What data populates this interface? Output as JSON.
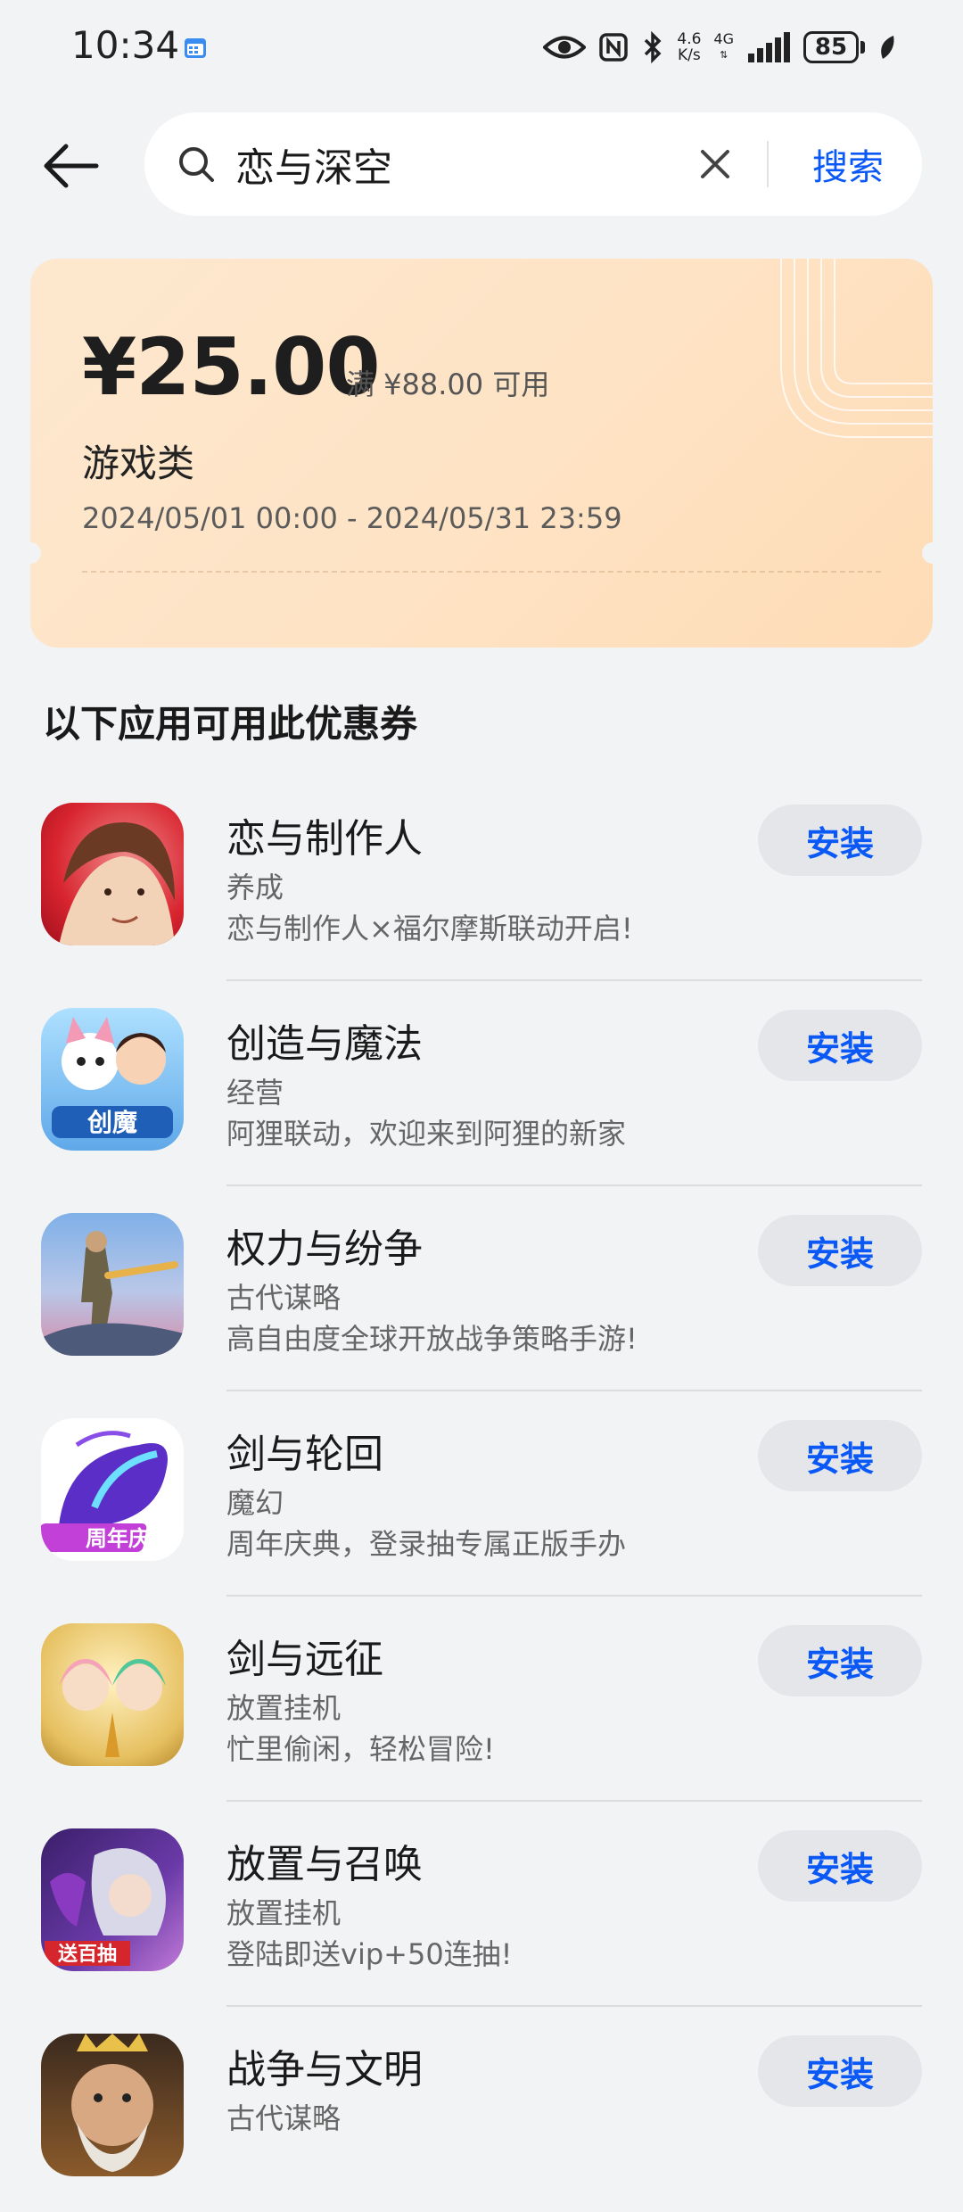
{
  "status_bar": {
    "time": "10:34",
    "net_speed_value": "4.6",
    "net_speed_unit": "K/s",
    "network": "4G",
    "battery": "85"
  },
  "search": {
    "query": "恋与深空",
    "button_label": "搜索"
  },
  "coupon": {
    "amount": "¥25.00",
    "threshold": "满 ¥88.00 可用",
    "category": "游戏类",
    "validity": "2024/05/01 00:00 - 2024/05/31 23:59"
  },
  "section_title": "以下应用可用此优惠券",
  "install_label": "安装",
  "apps": [
    {
      "name": "恋与制作人",
      "category": "养成",
      "desc": "恋与制作人×福尔摩斯联动开启!",
      "icon": "lover-producer-icon",
      "color": "#d8242f"
    },
    {
      "name": "创造与魔法",
      "category": "经营",
      "desc": "阿狸联动，欢迎来到阿狸的新家",
      "icon": "create-magic-icon",
      "color": "#5fa8e8"
    },
    {
      "name": "权力与纷争",
      "category": "古代谋略",
      "desc": "高自由度全球开放战争策略手游!",
      "icon": "power-conflict-icon",
      "color": "#5f86c4"
    },
    {
      "name": "剑与轮回",
      "category": "魔幻",
      "desc": "周年庆典，登录抽专属正版手办",
      "icon": "sword-reincarnation-icon",
      "color": "#5b2fc7"
    },
    {
      "name": "剑与远征",
      "category": "放置挂机",
      "desc": "忙里偷闲，轻松冒险!",
      "icon": "afk-arena-icon",
      "color": "#e6c060"
    },
    {
      "name": "放置与召唤",
      "category": "放置挂机",
      "desc": "登陆即送vip+50连抽!",
      "icon": "idle-summon-icon",
      "color": "#6a3aa8"
    },
    {
      "name": "战争与文明",
      "category": "古代谋略",
      "desc": "",
      "icon": "war-civilization-icon",
      "color": "#8a5a2b"
    }
  ],
  "app_icon_text": {
    "create_magic": "创魔",
    "sword_reincarnation": "周年庆",
    "idle_summon": "送百抽"
  },
  "colors": {
    "accent": "#0a59f7",
    "background": "#f1f3f5",
    "coupon_bg": "#fee3c4",
    "install_bg": "#e4e6e9"
  }
}
